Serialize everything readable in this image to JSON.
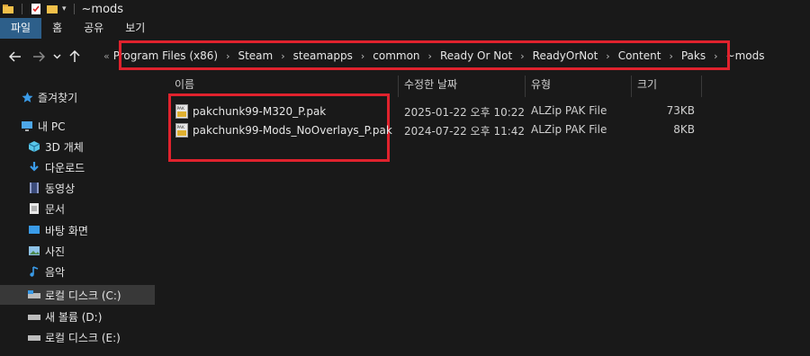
{
  "window": {
    "title": "~mods"
  },
  "ribbon": {
    "tabs": [
      "파일",
      "홈",
      "공유",
      "보기"
    ]
  },
  "address": {
    "overflow": "«",
    "crumbs": [
      "Program Files (x86)",
      "Steam",
      "steamapps",
      "common",
      "Ready Or Not",
      "ReadyOrNot",
      "Content",
      "Paks",
      "~mods"
    ]
  },
  "sidebar": {
    "items": [
      {
        "label": "즐겨찾기",
        "icon": "star-icon"
      },
      {
        "label": "내 PC",
        "icon": "pc-icon"
      },
      {
        "label": "3D 개체",
        "icon": "3d-objects-icon"
      },
      {
        "label": "다운로드",
        "icon": "download-icon"
      },
      {
        "label": "동영상",
        "icon": "video-icon"
      },
      {
        "label": "문서",
        "icon": "document-icon"
      },
      {
        "label": "바탕 화면",
        "icon": "desktop-icon"
      },
      {
        "label": "사진",
        "icon": "pictures-icon"
      },
      {
        "label": "음악",
        "icon": "music-icon"
      },
      {
        "label": "로컬 디스크 (C:)",
        "icon": "drive-icon",
        "selected": true
      },
      {
        "label": "새 볼륨 (D:)",
        "icon": "drive-icon"
      },
      {
        "label": "로컬 디스크 (E:)",
        "icon": "drive-icon"
      }
    ]
  },
  "columns": {
    "name": "이름",
    "modified": "수정한 날짜",
    "type": "유형",
    "size": "크기"
  },
  "files": [
    {
      "name": "pakchunk99-M320_P.pak",
      "modified": "2025-01-22 오후 10:22",
      "type": "ALZip PAK File",
      "size": "73KB"
    },
    {
      "name": "pakchunk99-Mods_NoOverlays_P.pak",
      "modified": "2024-07-22 오후 11:42",
      "type": "ALZip PAK File",
      "size": "8KB"
    }
  ],
  "colors": {
    "accent": "#2d5f8a",
    "highlight_box": "#e0222d",
    "background": "#191919"
  }
}
